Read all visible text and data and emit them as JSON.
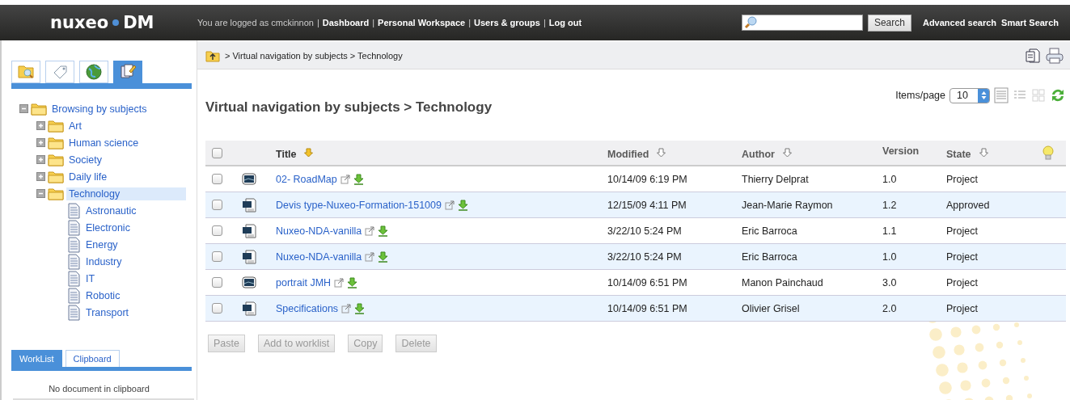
{
  "header": {
    "logo": {
      "brand": "nuxeo",
      "product": "DM"
    },
    "user_text": "You are logged as cmckinnon",
    "link_separator": "|",
    "links": [
      "Dashboard",
      "Personal Workspace",
      "Users & groups",
      "Log out"
    ],
    "search": {
      "button": "Search"
    },
    "search_links": [
      "Advanced search",
      "Smart Search"
    ]
  },
  "sidebar": {
    "tabs": [
      {
        "kind": "search",
        "selected": false
      },
      {
        "kind": "tag",
        "selected": false
      },
      {
        "kind": "globe",
        "selected": false
      },
      {
        "kind": "browse",
        "selected": true
      }
    ],
    "tree": {
      "label": "Browsing by subjects",
      "kind": "folder",
      "expanded": true,
      "selected": false,
      "children": [
        {
          "label": "Art",
          "kind": "folder",
          "expanded": false,
          "selected": false
        },
        {
          "label": "Human science",
          "kind": "folder",
          "expanded": false,
          "selected": false
        },
        {
          "label": "Society",
          "kind": "folder",
          "expanded": false,
          "selected": false
        },
        {
          "label": "Daily life",
          "kind": "folder",
          "expanded": false,
          "selected": false
        },
        {
          "label": "Technology",
          "kind": "folder",
          "expanded": true,
          "selected": true,
          "children": [
            {
              "label": "Astronautic",
              "kind": "document",
              "selected": false
            },
            {
              "label": "Electronic",
              "kind": "document",
              "selected": false
            },
            {
              "label": "Energy",
              "kind": "document",
              "selected": false
            },
            {
              "label": "Industry",
              "kind": "document",
              "selected": false
            },
            {
              "label": "IT",
              "kind": "document",
              "selected": false
            },
            {
              "label": "Robotic",
              "kind": "document",
              "selected": false
            },
            {
              "label": "Transport",
              "kind": "document",
              "selected": false
            }
          ]
        }
      ]
    },
    "bottom_tabs": [
      {
        "label": "WorkList",
        "selected": true
      },
      {
        "label": "Clipboard",
        "selected": false
      }
    ],
    "clipboard_message": "No document in clipboard"
  },
  "breadcrumb": "> Virtual navigation by subjects > Technology",
  "page_title": "Virtual navigation by subjects > Technology",
  "items_per_page": {
    "label": "Items/page",
    "value": "10"
  },
  "view_modes": [
    {
      "kind": "list",
      "selected": true
    },
    {
      "kind": "details",
      "selected": false
    },
    {
      "kind": "grid",
      "selected": false
    }
  ],
  "table": {
    "select_all": {
      "checked": false
    },
    "columns": [
      {
        "label": "Title",
        "sortable": true,
        "sorted": true
      },
      {
        "label": "Modified",
        "sortable": true,
        "sorted": false
      },
      {
        "label": "Author",
        "sortable": true,
        "sorted": false
      },
      {
        "label": "Version",
        "sortable": false,
        "sorted": false
      },
      {
        "label": "State",
        "sortable": true,
        "sorted": false
      }
    ],
    "rows": [
      {
        "checked": false,
        "kind": "picture",
        "title": "02- RoadMap",
        "modified": "10/14/09 6:19 PM",
        "author": "Thierry Delprat",
        "version": "1.0",
        "state": "Project"
      },
      {
        "checked": false,
        "kind": "document",
        "title": "Devis type-Nuxeo-Formation-151009",
        "modified": "12/15/09 4:11 PM",
        "author": "Jean-Marie Raymon",
        "version": "1.2",
        "state": "Approved"
      },
      {
        "checked": false,
        "kind": "document",
        "title": "Nuxeo-NDA-vanilla",
        "modified": "3/22/10 5:24 PM",
        "author": "Eric Barroca",
        "version": "1.1",
        "state": "Project"
      },
      {
        "checked": false,
        "kind": "document",
        "title": "Nuxeo-NDA-vanilla",
        "modified": "3/22/10 5:24 PM",
        "author": "Eric Barroca",
        "version": "1.0",
        "state": "Project"
      },
      {
        "checked": false,
        "kind": "picture",
        "title": "portrait JMH",
        "modified": "10/14/09 6:51 PM",
        "author": "Manon Painchaud",
        "version": "3.0",
        "state": "Project"
      },
      {
        "checked": false,
        "kind": "document",
        "title": "Specifications",
        "modified": "10/14/09 6:51 PM",
        "author": "Olivier Grisel",
        "version": "2.0",
        "state": "Project"
      }
    ]
  },
  "actions": [
    {
      "label": "Paste",
      "disabled": true
    },
    {
      "label": "Add to worklist",
      "disabled": true
    },
    {
      "label": "Copy",
      "disabled": true
    },
    {
      "label": "Delete",
      "disabled": true
    }
  ]
}
